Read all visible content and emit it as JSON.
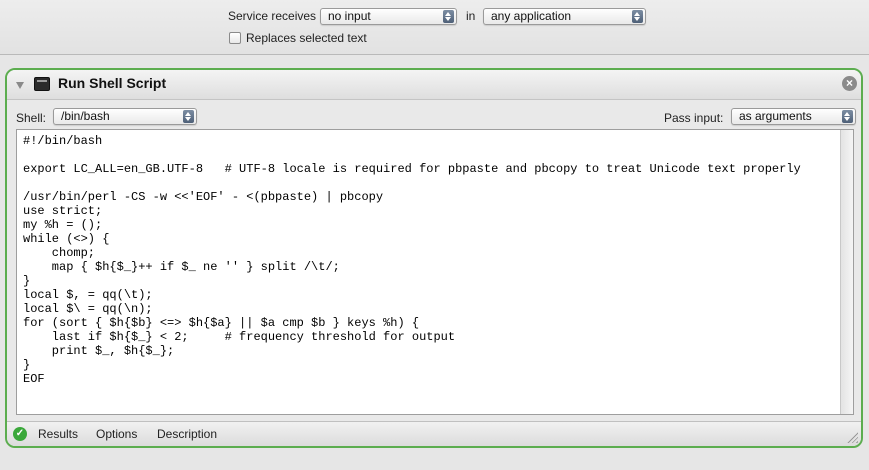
{
  "service": {
    "receives_label": "Service receives",
    "input_value": "no input",
    "in_label": "in",
    "application_value": "any application",
    "replaces_label": "Replaces selected text",
    "replaces_checked": false
  },
  "action": {
    "title": "Run Shell Script",
    "shell_label": "Shell:",
    "shell_value": "/bin/bash",
    "pass_input_label": "Pass input:",
    "pass_input_value": "as arguments",
    "script": "#!/bin/bash\n\nexport LC_ALL=en_GB.UTF-8   # UTF-8 locale is required for pbpaste and pbcopy to treat Unicode text properly\n\n/usr/bin/perl -CS -w <<'EOF' - <(pbpaste) | pbcopy\nuse strict;\nmy %h = ();\nwhile (<>) {\n    chomp;\n    map { $h{$_}++ if $_ ne '' } split /\\t/;\n}\nlocal $, = qq(\\t);\nlocal $\\ = qq(\\n);\nfor (sort { $h{$b} <=> $h{$a} || $a cmp $b } keys %h) {\n    last if $h{$_} < 2;     # frequency threshold for output\n    print $_, $h{$_};\n}\nEOF",
    "footer": {
      "results_label": "Results",
      "options_label": "Options",
      "description_label": "Description"
    }
  },
  "icons": {
    "disclosure": "disclosure-triangle-icon",
    "terminal": "terminal-icon",
    "close": "close-icon",
    "status": "checkmark-icon",
    "resize": "resize-grip-icon"
  },
  "colors": {
    "panel_border": "#5cad4f",
    "status_ok": "#3aa83a",
    "popup_arrows": "#5c6e86"
  }
}
